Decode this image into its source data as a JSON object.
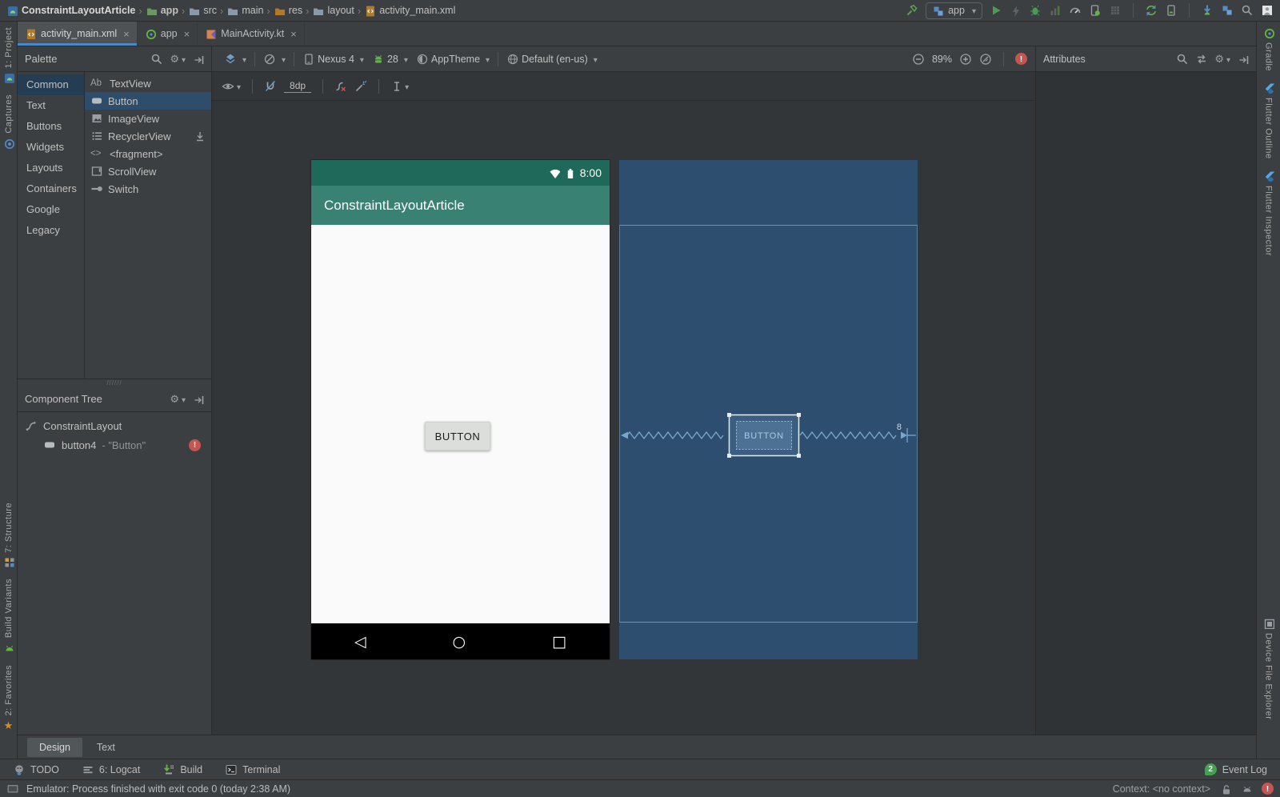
{
  "colors": {
    "appbar_teal": "#398273",
    "statusbar_teal": "#1E695A",
    "blueprint_bg": "#2D4E6F",
    "selection_blue": "#2D4D6B",
    "tab_accent": "#4A88C7",
    "error_red": "#C75450"
  },
  "menubar": {
    "breadcrumbs": [
      "ConstraintLayoutArticle",
      "app",
      "src",
      "main",
      "res",
      "layout",
      "activity_main.xml"
    ]
  },
  "run_toolbar": {
    "config": "app"
  },
  "editor_tabs": [
    {
      "label": "activity_main.xml"
    },
    {
      "label": "app"
    },
    {
      "label": "MainActivity.kt"
    }
  ],
  "stripes": {
    "left_top": [
      "1: Project",
      "Captures"
    ],
    "left_bottom": [
      "7: Structure",
      "Build Variants",
      "2: Favorites"
    ],
    "right_top": [
      "Gradle",
      "Flutter Outline",
      "Flutter Inspector"
    ],
    "right_bottom": [
      "Device File Explorer"
    ]
  },
  "palette": {
    "title": "Palette",
    "categories": [
      "Common",
      "Text",
      "Buttons",
      "Widgets",
      "Layouts",
      "Containers",
      "Google",
      "Legacy"
    ],
    "components": [
      "TextView",
      "Button",
      "ImageView",
      "RecyclerView",
      "<fragment>",
      "ScrollView",
      "Switch"
    ],
    "textview_glyph": "Ab",
    "fragment_glyph": "<>"
  },
  "component_tree": {
    "title": "Component Tree",
    "root": "ConstraintLayout",
    "child": "button4",
    "child_suffix": "- \"Button\""
  },
  "design_toolbar": {
    "device": "Nexus 4",
    "api": "28",
    "theme": "AppTheme",
    "locale": "Default (en-us)",
    "zoom_level": "89%",
    "default_margin": "8dp"
  },
  "attributes_panel": {
    "title": "Attributes"
  },
  "preview": {
    "time": "8:00",
    "app_title": "ConstraintLayoutArticle",
    "button_label": "BUTTON"
  },
  "blueprint": {
    "button_label": "BUTTON",
    "margin_label": "8"
  },
  "bottom_tabs": [
    {
      "label": "Design"
    },
    {
      "label": "Text"
    }
  ],
  "status_bar": {
    "tool_windows": [
      "TODO",
      "6: Logcat",
      "Build",
      "Terminal"
    ],
    "event_log": "Event Log",
    "event_count": "2",
    "message": "Emulator: Process finished with exit code 0 (today 2:38 AM)",
    "context": "Context: <no context>"
  }
}
